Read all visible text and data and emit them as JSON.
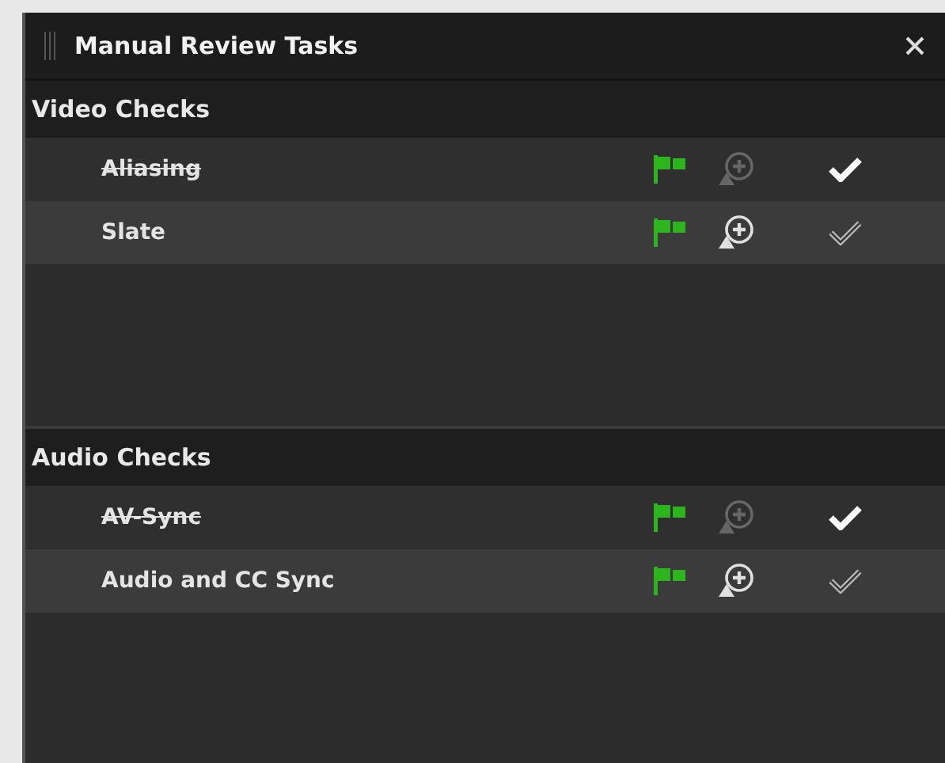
{
  "window": {
    "title": "Manual Review Tasks"
  },
  "sections": [
    {
      "title": "Video Checks",
      "tasks": [
        {
          "name": "Aliasing",
          "done": true
        },
        {
          "name": "Slate",
          "done": false
        }
      ]
    },
    {
      "title": "Audio Checks",
      "tasks": [
        {
          "name": "AV-Sync",
          "done": true
        },
        {
          "name": "Audio and CC Sync",
          "done": false
        }
      ]
    }
  ]
}
